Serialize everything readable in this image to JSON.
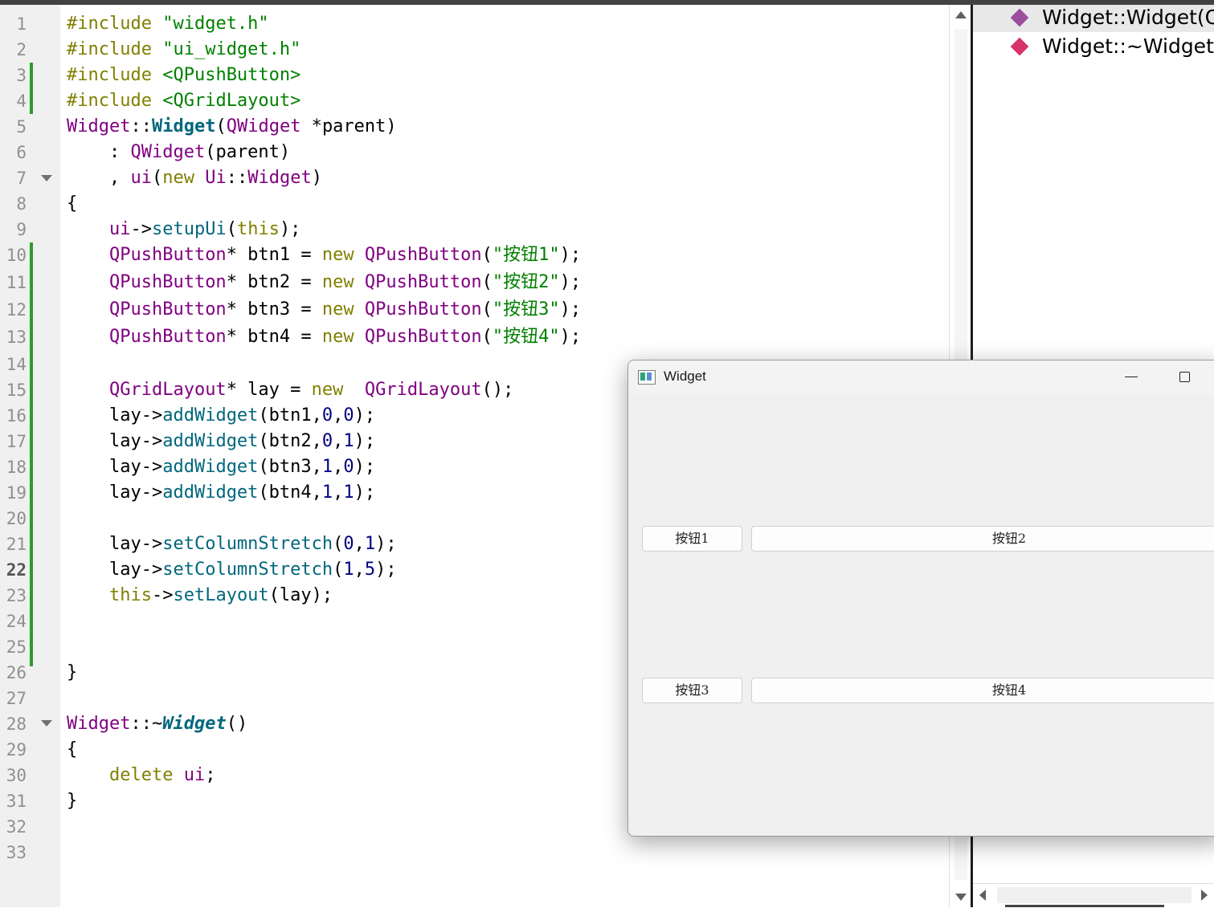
{
  "editor": {
    "line_numbers": [
      "1",
      "2",
      "3",
      "4",
      "5",
      "6",
      "7",
      "8",
      "9",
      "10",
      "11",
      "12",
      "13",
      "14",
      "15",
      "16",
      "17",
      "18",
      "19",
      "20",
      "21",
      "22",
      "23",
      "24",
      "25",
      "26",
      "27",
      "28",
      "29",
      "30",
      "31",
      "32",
      "33"
    ],
    "current_line": "22",
    "code": {
      "l1": {
        "a": "#include ",
        "b": "\"widget.h\""
      },
      "l2": {
        "a": "#include ",
        "b": "\"ui_widget.h\""
      },
      "l3": {
        "a": "#include ",
        "b": "<QPushButton>"
      },
      "l4": {
        "a": "#include ",
        "b": "<QGridLayout>"
      },
      "l5": {
        "a": "Widget",
        "b": "::",
        "c": "Widget",
        "d": "(",
        "e": "QWidget",
        "f": " *",
        "g": "parent",
        "h": ")"
      },
      "l6": {
        "a": "    : ",
        "b": "QWidget",
        "c": "(parent)"
      },
      "l7": {
        "a": "    , ",
        "b": "ui",
        "c": "(",
        "d": "new",
        "e": " ",
        "f": "Ui",
        "g": "::",
        "h": "Widget",
        "i": ")"
      },
      "l8": {
        "a": "{"
      },
      "l9": {
        "a": "    ",
        "b": "ui",
        "c": "->",
        "d": "setupUi",
        "e": "(",
        "f": "this",
        "g": ");"
      },
      "l10": {
        "a": "    ",
        "b": "QPushButton",
        "c": "* btn1 = ",
        "d": "new",
        "e": " ",
        "f": "QPushButton",
        "g": "(",
        "h": "\"按钮1\"",
        "i": ");"
      },
      "l11": {
        "a": "    ",
        "b": "QPushButton",
        "c": "* btn2 = ",
        "d": "new",
        "e": " ",
        "f": "QPushButton",
        "g": "(",
        "h": "\"按钮2\"",
        "i": ");"
      },
      "l12": {
        "a": "    ",
        "b": "QPushButton",
        "c": "* btn3 = ",
        "d": "new",
        "e": " ",
        "f": "QPushButton",
        "g": "(",
        "h": "\"按钮3\"",
        "i": ");"
      },
      "l13": {
        "a": "    ",
        "b": "QPushButton",
        "c": "* btn4 = ",
        "d": "new",
        "e": " ",
        "f": "QPushButton",
        "g": "(",
        "h": "\"按钮4\"",
        "i": ");"
      },
      "l15": {
        "a": "    ",
        "b": "QGridLayout",
        "c": "* lay = ",
        "d": "new",
        "e": "  ",
        "f": "QGridLayout",
        "g": "();"
      },
      "l16": {
        "a": "    lay->",
        "b": "addWidget",
        "c": "(btn1,",
        "d": "0",
        "e": ",",
        "f": "0",
        "g": ");"
      },
      "l17": {
        "a": "    lay->",
        "b": "addWidget",
        "c": "(btn2,",
        "d": "0",
        "e": ",",
        "f": "1",
        "g": ");"
      },
      "l18": {
        "a": "    lay->",
        "b": "addWidget",
        "c": "(btn3,",
        "d": "1",
        "e": ",",
        "f": "0",
        "g": ");"
      },
      "l19": {
        "a": "    lay->",
        "b": "addWidget",
        "c": "(btn4,",
        "d": "1",
        "e": ",",
        "f": "1",
        "g": ");"
      },
      "l21": {
        "a": "    lay->",
        "b": "setColumnStretch",
        "c": "(",
        "d": "0",
        "e": ",",
        "f": "1",
        "g": ");"
      },
      "l22": {
        "a": "    lay->",
        "b": "setColumnStretch",
        "c": "(",
        "d": "1",
        "e": ",",
        "f": "5",
        "g": ");"
      },
      "l23": {
        "a": "    ",
        "b": "this",
        "c": "->",
        "d": "setLayout",
        "e": "(lay);"
      },
      "l26": {
        "a": "}"
      },
      "l28": {
        "a": "Widget",
        "b": "::~",
        "c": "Widget",
        "d": "()"
      },
      "l29": {
        "a": "{"
      },
      "l30": {
        "a": "    ",
        "b": "delete",
        "c": " ",
        "d": "ui",
        "e": ";"
      },
      "l31": {
        "a": "}"
      }
    }
  },
  "outline": {
    "items": [
      {
        "label": "Widget::Widget(QWidget *parent)",
        "color": "#9b4f9f"
      },
      {
        "label": "Widget::~Widget()",
        "color": "#d6336c"
      }
    ]
  },
  "widget_window": {
    "title": "Widget",
    "buttons": [
      "按钮1",
      "按钮2",
      "按钮3",
      "按钮4"
    ]
  },
  "colors": {
    "keyword": "#808000",
    "type": "#800080",
    "string": "#008000",
    "function": "#00677c",
    "number": "#000080",
    "modified_marker": "#2f9a2f"
  }
}
